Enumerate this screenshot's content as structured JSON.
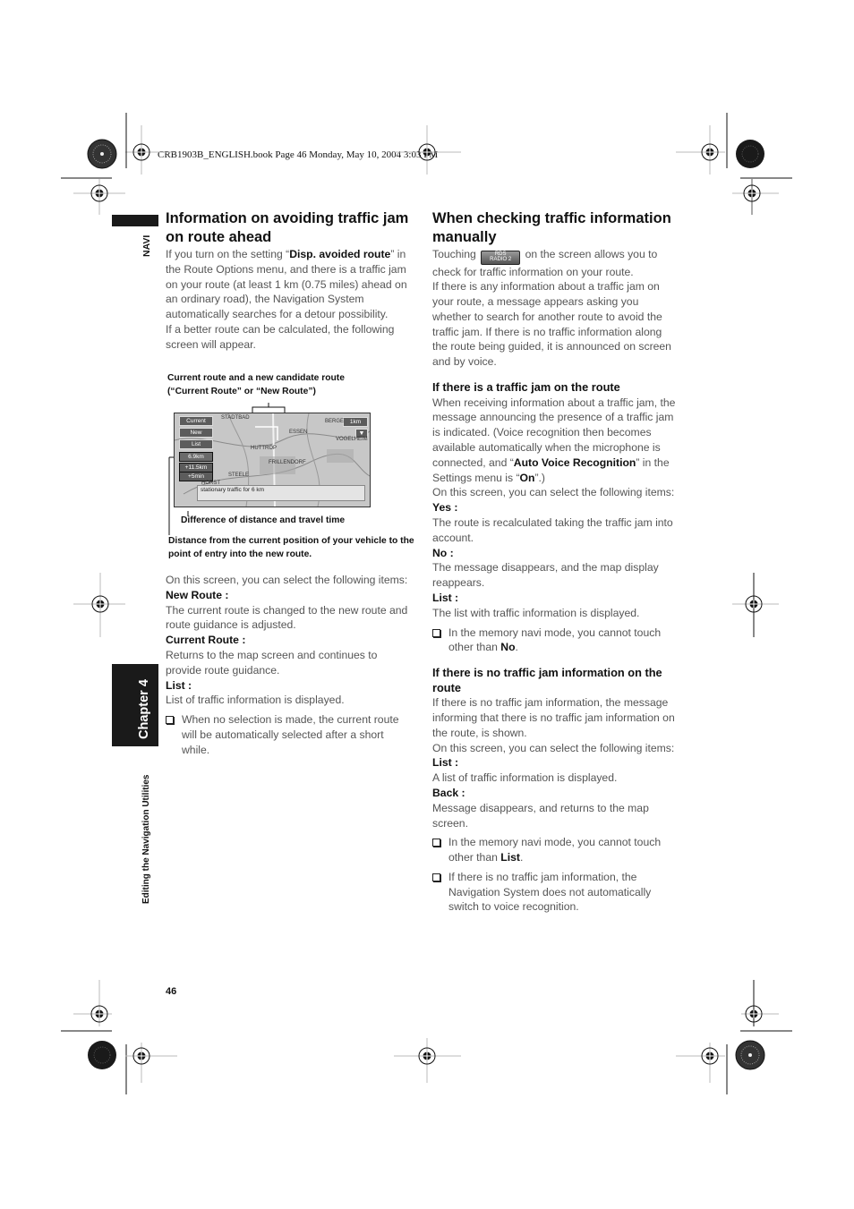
{
  "print_header": "CRB1903B_ENGLISH.book  Page 46  Monday, May 10, 2004  3:03 PM",
  "side": {
    "section_label": "NAVI",
    "chapter_label": "Chapter 4",
    "chapter_title": "Editing the Navigation Utilities"
  },
  "page_number": "46",
  "left": {
    "title": "Information on avoiding traffic jam on route ahead",
    "intro_1_pre": "If you turn on the setting “",
    "intro_1_bold": "Disp. avoided route",
    "intro_1_post": "” in the Route Options menu, and there is a traffic jam on your route (at least 1 km (0.75 miles) ahead on an ordinary road), the Navigation System automatically searches for a detour possibility.",
    "intro_2": "If a better route can be calculated, the following screen will appear.",
    "figure": {
      "caption_top": "Current route and a new candidate route (“Current Route” or “New Route”)",
      "caption_mid": "Difference of distance and travel time",
      "caption_bottom": "Distance from the current position of your vehicle to the point of entry into the new route.",
      "screen": {
        "btn_current": "Current",
        "btn_new": "New",
        "btn_list": "List",
        "distance": "6.9km",
        "diff_distance": "+11.5km",
        "diff_time": "+5min",
        "scale": "1km",
        "message": "stationary traffic for 6 km",
        "place_labels": [
          "STADTBAD",
          "ESSEN",
          "HUTTROP",
          "FRILLENDORF",
          "STEELE",
          "HORST",
          "VOGELHEIM",
          "BERGE"
        ]
      }
    },
    "select_intro": "On this screen, you can select the following items:",
    "items": [
      {
        "term": "New Route :",
        "desc": "The current route is changed to the new route and route guidance is adjusted."
      },
      {
        "term": "Current Route :",
        "desc": "Returns to the map screen and continues to provide route guidance."
      },
      {
        "term": "List :",
        "desc": "List of traffic information is displayed."
      }
    ],
    "note": "When no selection is made, the current route will be automatically selected after a short while."
  },
  "right": {
    "title": "When checking traffic information manually",
    "intro_pre": "Touching",
    "intro_icon_label_top": "RDS",
    "intro_icon_label_bottom": "RADIO 2",
    "intro_post": "on the screen allows you to check for traffic information on your route.",
    "intro_2": "If there is any information about a traffic jam on your route, a message appears asking you whether to search for another route to avoid the traffic jam. If there is no traffic information along the route being guided, it is announced on screen and by voice.",
    "sec1": {
      "title": "If there is a traffic jam on the route",
      "body_pre": "When receiving information about a traffic jam, the message announcing the presence of a traffic jam is indicated. (Voice recognition then becomes available automatically when the microphone is connected, and “",
      "body_bold1": "Auto Voice Recognition",
      "body_mid": "” in the Settings menu is “",
      "body_bold2": "On",
      "body_post": "”.)",
      "select_intro": "On this screen, you can select the following items:",
      "items": [
        {
          "term": "Yes :",
          "desc": "The route is recalculated taking the traffic jam into account."
        },
        {
          "term": "No :",
          "desc": "The message disappears, and the map display reappears."
        },
        {
          "term": "List :",
          "desc": "The list with traffic information is displayed."
        }
      ],
      "note_pre": "In the memory navi mode, you cannot touch other than ",
      "note_bold": "No",
      "note_post": "."
    },
    "sec2": {
      "title": "If there is no traffic jam information on the route",
      "body": "If there is no traffic jam information, the message informing that there is no traffic jam information on the route, is shown.",
      "select_intro": "On this screen, you can select the following items:",
      "items": [
        {
          "term": "List :",
          "desc": "A list of traffic information is displayed."
        },
        {
          "term": "Back :",
          "desc": "Message disappears, and returns to the map screen."
        }
      ],
      "note1_pre": "In the memory navi mode, you cannot touch other than ",
      "note1_bold": "List",
      "note1_post": ".",
      "note2": "If there is no traffic jam information, the Navigation System does not automatically switch to voice recognition."
    }
  }
}
